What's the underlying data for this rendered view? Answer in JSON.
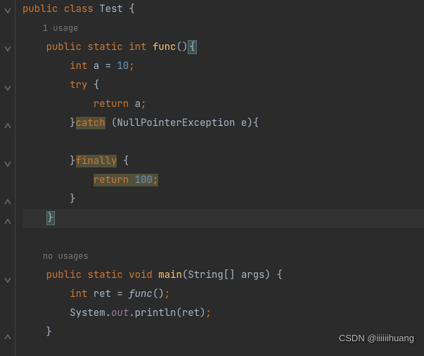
{
  "code": {
    "l1": {
      "kw1": "public",
      "kw2": "class",
      "name": "Test",
      "brace": " {"
    },
    "l2": {
      "hint": "1 usage"
    },
    "l3": {
      "kw1": "public",
      "kw2": "static",
      "type": "int",
      "name": "func",
      "paren": "()",
      "brace": "{"
    },
    "l4": {
      "type": "int",
      "var": " a = ",
      "num": "10",
      "semi": ";"
    },
    "l5": {
      "kw": "try",
      "brace": " {"
    },
    "l6": {
      "kw": "return",
      "var": " a",
      "semi": ";"
    },
    "l7": {
      "close": "}",
      "kw": "catch",
      "paren": " (NullPointerException e){"
    },
    "l8": {
      "blank": ""
    },
    "l9": {
      "close": "}",
      "kw": "finally",
      "brace": " {"
    },
    "l10": {
      "kw": "return",
      "sp": " ",
      "num": "100",
      "semi": ";"
    },
    "l11": {
      "close": "}"
    },
    "l12": {
      "close": "}"
    },
    "l13": {
      "blank": ""
    },
    "l14": {
      "hint": "no usages"
    },
    "l15": {
      "kw1": "public",
      "kw2": "static",
      "kw3": "void",
      "name": "main",
      "params": "(String[] args) {"
    },
    "l16": {
      "type": "int",
      "var": " ret = ",
      "call": "func",
      "rest": "()",
      "semi": ";"
    },
    "l17": {
      "cls": "System.",
      "field": "out",
      "method": ".println(ret)",
      "semi": ";"
    },
    "l18": {
      "close": "}"
    }
  },
  "watermark": "CSDN @iiiiiihuang"
}
